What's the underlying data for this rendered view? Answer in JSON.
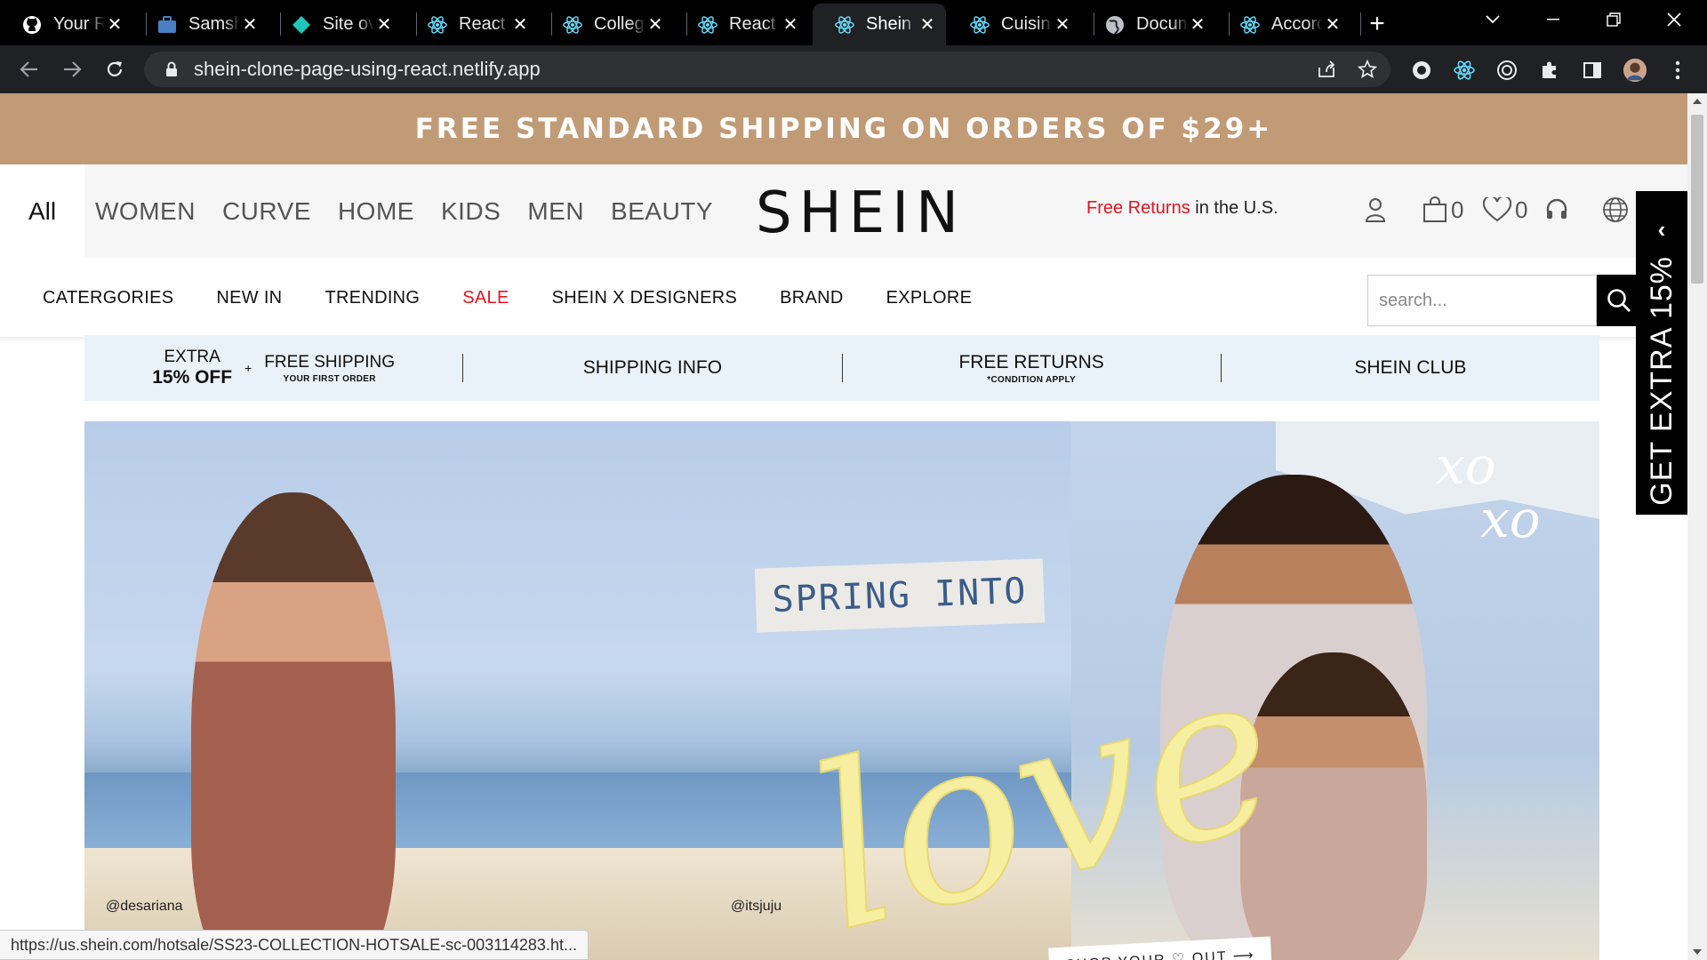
{
  "browser": {
    "tabs": [
      {
        "title": "Your Re",
        "icon": "github-icon"
      },
      {
        "title": "Samsh",
        "icon": "briefcase-icon"
      },
      {
        "title": "Site ov",
        "icon": "netlify-icon"
      },
      {
        "title": "React /",
        "icon": "react-icon"
      },
      {
        "title": "College",
        "icon": "react-icon"
      },
      {
        "title": "React /",
        "icon": "react-icon"
      },
      {
        "title": "Shein C",
        "icon": "react-icon",
        "active": true
      },
      {
        "title": "Cuisine",
        "icon": "react-icon"
      },
      {
        "title": "Docum",
        "icon": "globe-icon"
      },
      {
        "title": "Accord",
        "icon": "react-icon"
      }
    ],
    "close_glyph": "✕",
    "new_tab_glyph": "+",
    "url": "shein-clone-page-using-react.netlify.app",
    "status_url": "https://us.shein.com/hotsale/SS23-COLLECTION-HOTSALE-sc-003114283.ht..."
  },
  "promo_banner": {
    "text": "FREE STANDARD SHIPPING ON ORDERS OF $29+",
    "color": "#c19b76"
  },
  "header": {
    "all_label": "All",
    "categories": [
      "WOMEN",
      "CURVE",
      "HOME",
      "KIDS",
      "MEN",
      "BEAUTY"
    ],
    "logo": "SHEIN",
    "free_returns_red": "Free Returns",
    "free_returns_rest": " in the U.S.",
    "cart_count": "0",
    "wishlist_count": "0"
  },
  "subnav": {
    "links": [
      {
        "label": "CATERGORIES"
      },
      {
        "label": "NEW IN"
      },
      {
        "label": "TRENDING"
      },
      {
        "label": "SALE",
        "highlight": true
      },
      {
        "label": "SHEIN X DESIGNERS"
      },
      {
        "label": "BRAND"
      },
      {
        "label": "EXPLORE"
      }
    ],
    "search_placeholder": "search..."
  },
  "benefits": {
    "extra_line1": "EXTRA",
    "extra_line2": "15% OFF",
    "plus": "+",
    "free_shipping": "FREE SHIPPING",
    "free_shipping_sub": "YOUR FIRST ORDER",
    "shipping_info": "SHIPPING INFO",
    "free_returns": "FREE RETURNS",
    "free_returns_sub": "*CONDITION APPLY",
    "club": "SHEIN CLUB"
  },
  "hero": {
    "spring_text": "SPRING INTO",
    "love_text": "love",
    "xoxo_line1": "xo",
    "xoxo_line2": "xo",
    "handle_left": "@desariana",
    "handle_right": "@itsjuju",
    "shop_text": "SHOP YOUR ♡ OUT ⟶"
  },
  "side_promo": {
    "chevron": "‹",
    "text": "GET EXTRA 15%"
  },
  "colors": {
    "accent_red": "#e5141f",
    "benefit_bg": "#eaf2f9"
  }
}
